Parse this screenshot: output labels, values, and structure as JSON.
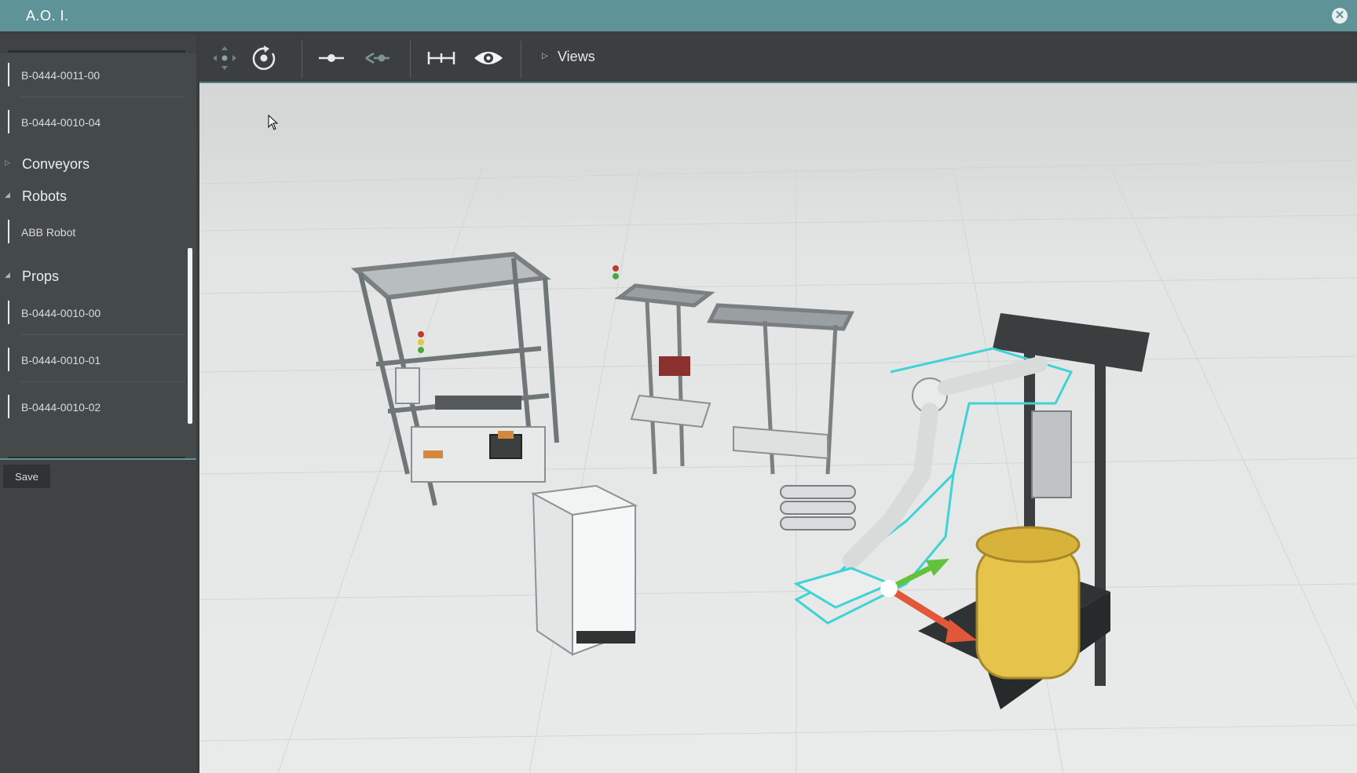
{
  "app": {
    "title": "A.O. I."
  },
  "sidebar": {
    "items": [
      {
        "type": "item",
        "label": "B-0444-0011-00"
      },
      {
        "type": "item",
        "label": "B-0444-0010-04"
      },
      {
        "type": "category",
        "label": "Conveyors",
        "expanded": false
      },
      {
        "type": "category",
        "label": "Robots",
        "expanded": true
      },
      {
        "type": "item",
        "label": "ABB Robot"
      },
      {
        "type": "category",
        "label": "Props",
        "expanded": true
      },
      {
        "type": "item",
        "label": "B-0444-0010-00"
      },
      {
        "type": "item",
        "label": "B-0444-0010-01"
      },
      {
        "type": "item",
        "label": "B-0444-0010-02"
      }
    ],
    "save_label": "Save"
  },
  "toolbar": {
    "tools": [
      "move-icon",
      "rotate-icon",
      "snap-point-icon",
      "snap-edge-icon",
      "measure-icon",
      "eye-icon"
    ],
    "views_label": "Views"
  },
  "colors": {
    "titlebar": "#5e9397",
    "selection_outline": "#3fd3d6",
    "gizmo_x": "#e2563a",
    "gizmo_y": "#63c23c",
    "barrel": "#e9c64a"
  }
}
